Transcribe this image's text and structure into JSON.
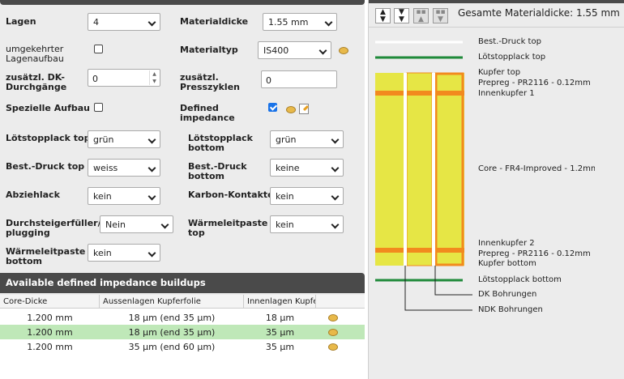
{
  "form": {
    "lagen": {
      "label": "Lagen",
      "value": "4"
    },
    "materialdicke": {
      "label": "Materialdicke",
      "value": "1.55 mm"
    },
    "umgekehrter": {
      "label": "umgekehrter Lagenaufbau",
      "checked": false
    },
    "materialtyp": {
      "label": "Materialtyp",
      "value": "IS400"
    },
    "dk": {
      "label": "zusätzl. DK-Durchgänge",
      "value": "0"
    },
    "presszyklen": {
      "label": "zusätzl. Presszyklen",
      "value": "0"
    },
    "spezielle": {
      "label": "Spezielle Aufbau",
      "checked": false
    },
    "impedance": {
      "label": "Defined impedance",
      "checked": true
    },
    "loetstopp_top": {
      "label": "Lötstopplack top",
      "value": "grün"
    },
    "loetstopp_bottom": {
      "label": "Lötstopplack bottom",
      "value": "grün"
    },
    "bestdruck_top": {
      "label": "Best.-Druck top",
      "value": "weiss"
    },
    "bestdruck_bottom": {
      "label": "Best.-Druck bottom",
      "value": "keine"
    },
    "abziehlack": {
      "label": "Abziehlack",
      "value": "kein"
    },
    "karbon": {
      "label": "Karbon-Kontakte",
      "value": "kein"
    },
    "durchsteiger": {
      "label": "Durchsteigerfüller/Hole plugging",
      "value": "Nein"
    },
    "waermeleit_top": {
      "label": "Wärmeleitpaste top",
      "value": "kein"
    },
    "waermeleit_bottom": {
      "label": "Wärmeleitpaste bottom",
      "value": "kein"
    }
  },
  "impedance_section": {
    "title": "Available defined impedance buildups",
    "columns": [
      "Core-Dicke",
      "Aussenlagen Kupferfolie",
      "Innenlagen Kupfer"
    ],
    "rows": [
      {
        "core": "1.200 mm",
        "outer": "18 µm (end 35 µm)",
        "inner": "18 µm",
        "selected": false
      },
      {
        "core": "1.200 mm",
        "outer": "18 µm (end 35 µm)",
        "inner": "35 µm",
        "selected": true
      },
      {
        "core": "1.200 mm",
        "outer": "35 µm (end 60 µm)",
        "inner": "35 µm",
        "selected": false
      }
    ]
  },
  "stackup": {
    "total": "Gesamte Materialdicke: 1.55 mm",
    "labels": {
      "bestdruck_top": "Best.-Druck top",
      "loetstopp_top": "Lötstopplack top",
      "kupfer_top": "Kupfer top",
      "prepreg_top": "Prepreg - PR2116 - 0.12mm",
      "innenkupfer1": "Innenkupfer 1",
      "core": "Core - FR4-Improved - 1.2mm",
      "innenkupfer2": "Innenkupfer 2",
      "prepreg_bottom": "Prepreg - PR2116 - 0.12mm",
      "kupfer_bottom": "Kupfer bottom",
      "loetstopp_bottom": "Lötstopplack bottom",
      "dk": "DK Bohrungen",
      "ndk": "NDK Bohrungen"
    },
    "colors": {
      "copper": "#f28a1e",
      "substrate": "#e6e645",
      "soldermask": "#1f8a3a",
      "silkscreen": "#ffffff"
    }
  }
}
